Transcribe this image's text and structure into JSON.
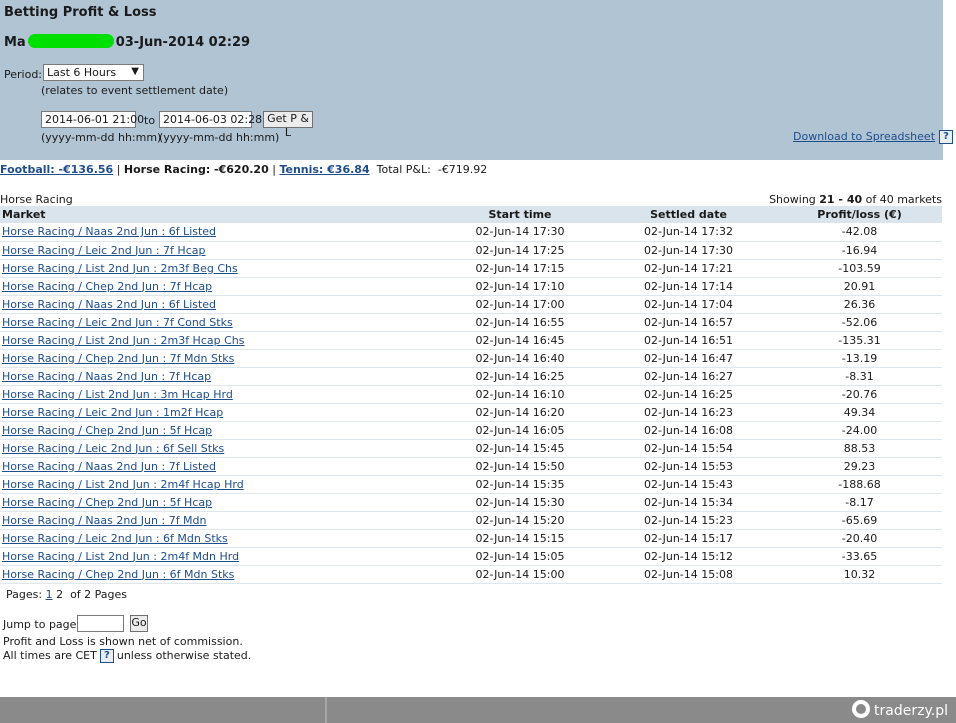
{
  "header": {
    "title": "Betting Profit & Loss",
    "account_prefix": "Ma",
    "timestamp": "03-Jun-2014 02:29",
    "period_label": "Period:",
    "period_value": "Last 6 Hours",
    "period_note": "(relates to event settlement date)",
    "from_value": "2014-06-01 21:00",
    "to_label": "to",
    "to_value": "2014-06-03 02:28",
    "get_button": "Get P & L",
    "format_hint": "(yyyy-mm-dd hh:mm)",
    "download_link": "Download to Spreadsheet",
    "help_glyph": "?"
  },
  "summary": {
    "football": "Football: -€136.56",
    "horse_racing": "Horse Racing: -€620.20",
    "tennis": "Tennis: €36.84",
    "total_label": "Total P&L:",
    "total_value": "-€719.92",
    "sep": "|"
  },
  "section": {
    "label": "Horse Racing",
    "showing_prefix": "Showing",
    "showing_range": "21 - 40",
    "showing_suffix": "of 40 markets"
  },
  "table": {
    "headers": {
      "market": "Market",
      "start": "Start time",
      "settled": "Settled date",
      "pl": "Profit/loss (€)"
    },
    "rows": [
      {
        "market": "Horse Racing / Naas 2nd Jun : 6f Listed",
        "start": "02-Jun-14 17:30",
        "settled": "02-Jun-14 17:32",
        "pl": "-42.08"
      },
      {
        "market": "Horse Racing / Leic 2nd Jun : 7f Hcap",
        "start": "02-Jun-14 17:25",
        "settled": "02-Jun-14 17:30",
        "pl": "-16.94"
      },
      {
        "market": "Horse Racing / List 2nd Jun : 2m3f Beg Chs",
        "start": "02-Jun-14 17:15",
        "settled": "02-Jun-14 17:21",
        "pl": "-103.59"
      },
      {
        "market": "Horse Racing / Chep 2nd Jun : 7f Hcap",
        "start": "02-Jun-14 17:10",
        "settled": "02-Jun-14 17:14",
        "pl": "20.91"
      },
      {
        "market": "Horse Racing / Naas 2nd Jun : 6f Listed",
        "start": "02-Jun-14 17:00",
        "settled": "02-Jun-14 17:04",
        "pl": "26.36"
      },
      {
        "market": "Horse Racing / Leic 2nd Jun : 7f Cond Stks",
        "start": "02-Jun-14 16:55",
        "settled": "02-Jun-14 16:57",
        "pl": "-52.06"
      },
      {
        "market": "Horse Racing / List 2nd Jun : 2m3f Hcap Chs",
        "start": "02-Jun-14 16:45",
        "settled": "02-Jun-14 16:51",
        "pl": "-135.31"
      },
      {
        "market": "Horse Racing / Chep 2nd Jun : 7f Mdn Stks",
        "start": "02-Jun-14 16:40",
        "settled": "02-Jun-14 16:47",
        "pl": "-13.19"
      },
      {
        "market": "Horse Racing / Naas 2nd Jun : 7f Hcap",
        "start": "02-Jun-14 16:25",
        "settled": "02-Jun-14 16:27",
        "pl": "-8.31"
      },
      {
        "market": "Horse Racing / List 2nd Jun : 3m Hcap Hrd",
        "start": "02-Jun-14 16:10",
        "settled": "02-Jun-14 16:25",
        "pl": "-20.76"
      },
      {
        "market": "Horse Racing / Leic 2nd Jun : 1m2f Hcap",
        "start": "02-Jun-14 16:20",
        "settled": "02-Jun-14 16:23",
        "pl": "49.34"
      },
      {
        "market": "Horse Racing / Chep 2nd Jun : 5f Hcap",
        "start": "02-Jun-14 16:05",
        "settled": "02-Jun-14 16:08",
        "pl": "-24.00"
      },
      {
        "market": "Horse Racing / Leic 2nd Jun : 6f Sell Stks",
        "start": "02-Jun-14 15:45",
        "settled": "02-Jun-14 15:54",
        "pl": "88.53"
      },
      {
        "market": "Horse Racing / Naas 2nd Jun : 7f Listed",
        "start": "02-Jun-14 15:50",
        "settled": "02-Jun-14 15:53",
        "pl": "29.23"
      },
      {
        "market": "Horse Racing / List 2nd Jun : 2m4f Hcap Hrd",
        "start": "02-Jun-14 15:35",
        "settled": "02-Jun-14 15:43",
        "pl": "-188.68"
      },
      {
        "market": "Horse Racing / Chep 2nd Jun : 5f Hcap",
        "start": "02-Jun-14 15:30",
        "settled": "02-Jun-14 15:34",
        "pl": "-8.17"
      },
      {
        "market": "Horse Racing / Naas 2nd Jun : 7f Mdn",
        "start": "02-Jun-14 15:20",
        "settled": "02-Jun-14 15:23",
        "pl": "-65.69"
      },
      {
        "market": "Horse Racing / Leic 2nd Jun : 6f Mdn Stks",
        "start": "02-Jun-14 15:15",
        "settled": "02-Jun-14 15:17",
        "pl": "-20.40"
      },
      {
        "market": "Horse Racing / List 2nd Jun : 2m4f Mdn Hrd",
        "start": "02-Jun-14 15:05",
        "settled": "02-Jun-14 15:12",
        "pl": "-33.65"
      },
      {
        "market": "Horse Racing / Chep 2nd Jun : 6f Mdn Stks",
        "start": "02-Jun-14 15:00",
        "settled": "02-Jun-14 15:08",
        "pl": "10.32"
      }
    ]
  },
  "pagination": {
    "label": "Pages:",
    "page1": "1",
    "page2": "2",
    "of_text": "of 2 Pages",
    "jump_label": "Jump to page:",
    "jump_value": "",
    "go_label": "Go"
  },
  "notes": {
    "commission": "Profit and Loss is shown net of commission.",
    "times_prefix": "All times are CET",
    "times_suffix": "unless otherwise stated."
  },
  "watermark": "traderzy.pl",
  "colors": {
    "header_bg": "#b0c4d4",
    "table_header_bg": "#d9e4ec",
    "link": "#1f4e8c",
    "bottom_bar": "#8a8a8a"
  }
}
